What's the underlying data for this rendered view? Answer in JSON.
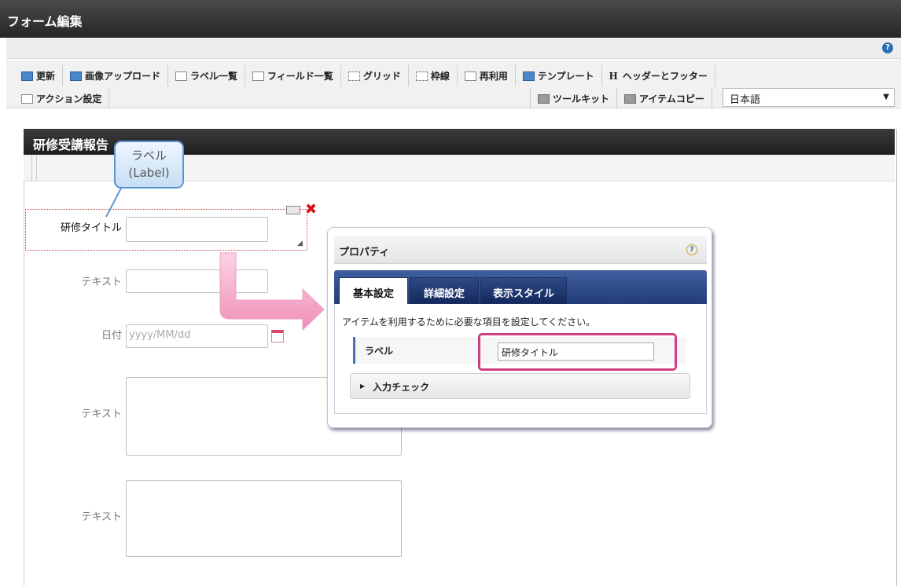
{
  "window": {
    "title": "フォーム編集"
  },
  "help_icon": "?",
  "toolbar": {
    "row1": [
      {
        "label": "更新",
        "icon": "update-icon"
      },
      {
        "label": "画像アップロード",
        "icon": "image-upload-icon"
      },
      {
        "label": "ラベル一覧",
        "icon": "label-list-icon"
      },
      {
        "label": "フィールド一覧",
        "icon": "field-list-icon"
      },
      {
        "label": "グリッド",
        "icon": "grid-icon"
      },
      {
        "label": "枠線",
        "icon": "border-icon"
      },
      {
        "label": "再利用",
        "icon": "reuse-icon"
      },
      {
        "label": "テンプレート",
        "icon": "template-icon"
      },
      {
        "label": "ヘッダーとフッター",
        "icon": "header-footer-icon"
      }
    ],
    "action_label": "アクション設定",
    "toolkit_label": "ツールキット",
    "item_copy_label": "アイテムコピー",
    "language": {
      "selected": "日本語"
    }
  },
  "form": {
    "title": "研修受講報告",
    "fields": [
      {
        "label": "研修タイトル",
        "value": ""
      },
      {
        "label": "テキスト",
        "value": ""
      },
      {
        "label": "日付",
        "placeholder": "yyyy/MM/dd"
      },
      {
        "label": "テキスト",
        "value": ""
      },
      {
        "label": "テキスト",
        "value": ""
      }
    ]
  },
  "callout": {
    "line1": "ラベル",
    "line2": "(Label)"
  },
  "properties": {
    "title": "プロパティ",
    "help": "?",
    "tabs": [
      "基本設定",
      "詳細設定",
      "表示スタイル"
    ],
    "active_tab": "基本設定",
    "description": "アイテムを利用するために必要な項目を設定してください。",
    "label_field": {
      "name": "ラベル",
      "value": "研修タイトル"
    },
    "input_check": "入力チェック"
  },
  "colors": {
    "tab_bar": "#2c4a88",
    "highlight": "#d13d82",
    "arrow": "#f3a9c8"
  }
}
